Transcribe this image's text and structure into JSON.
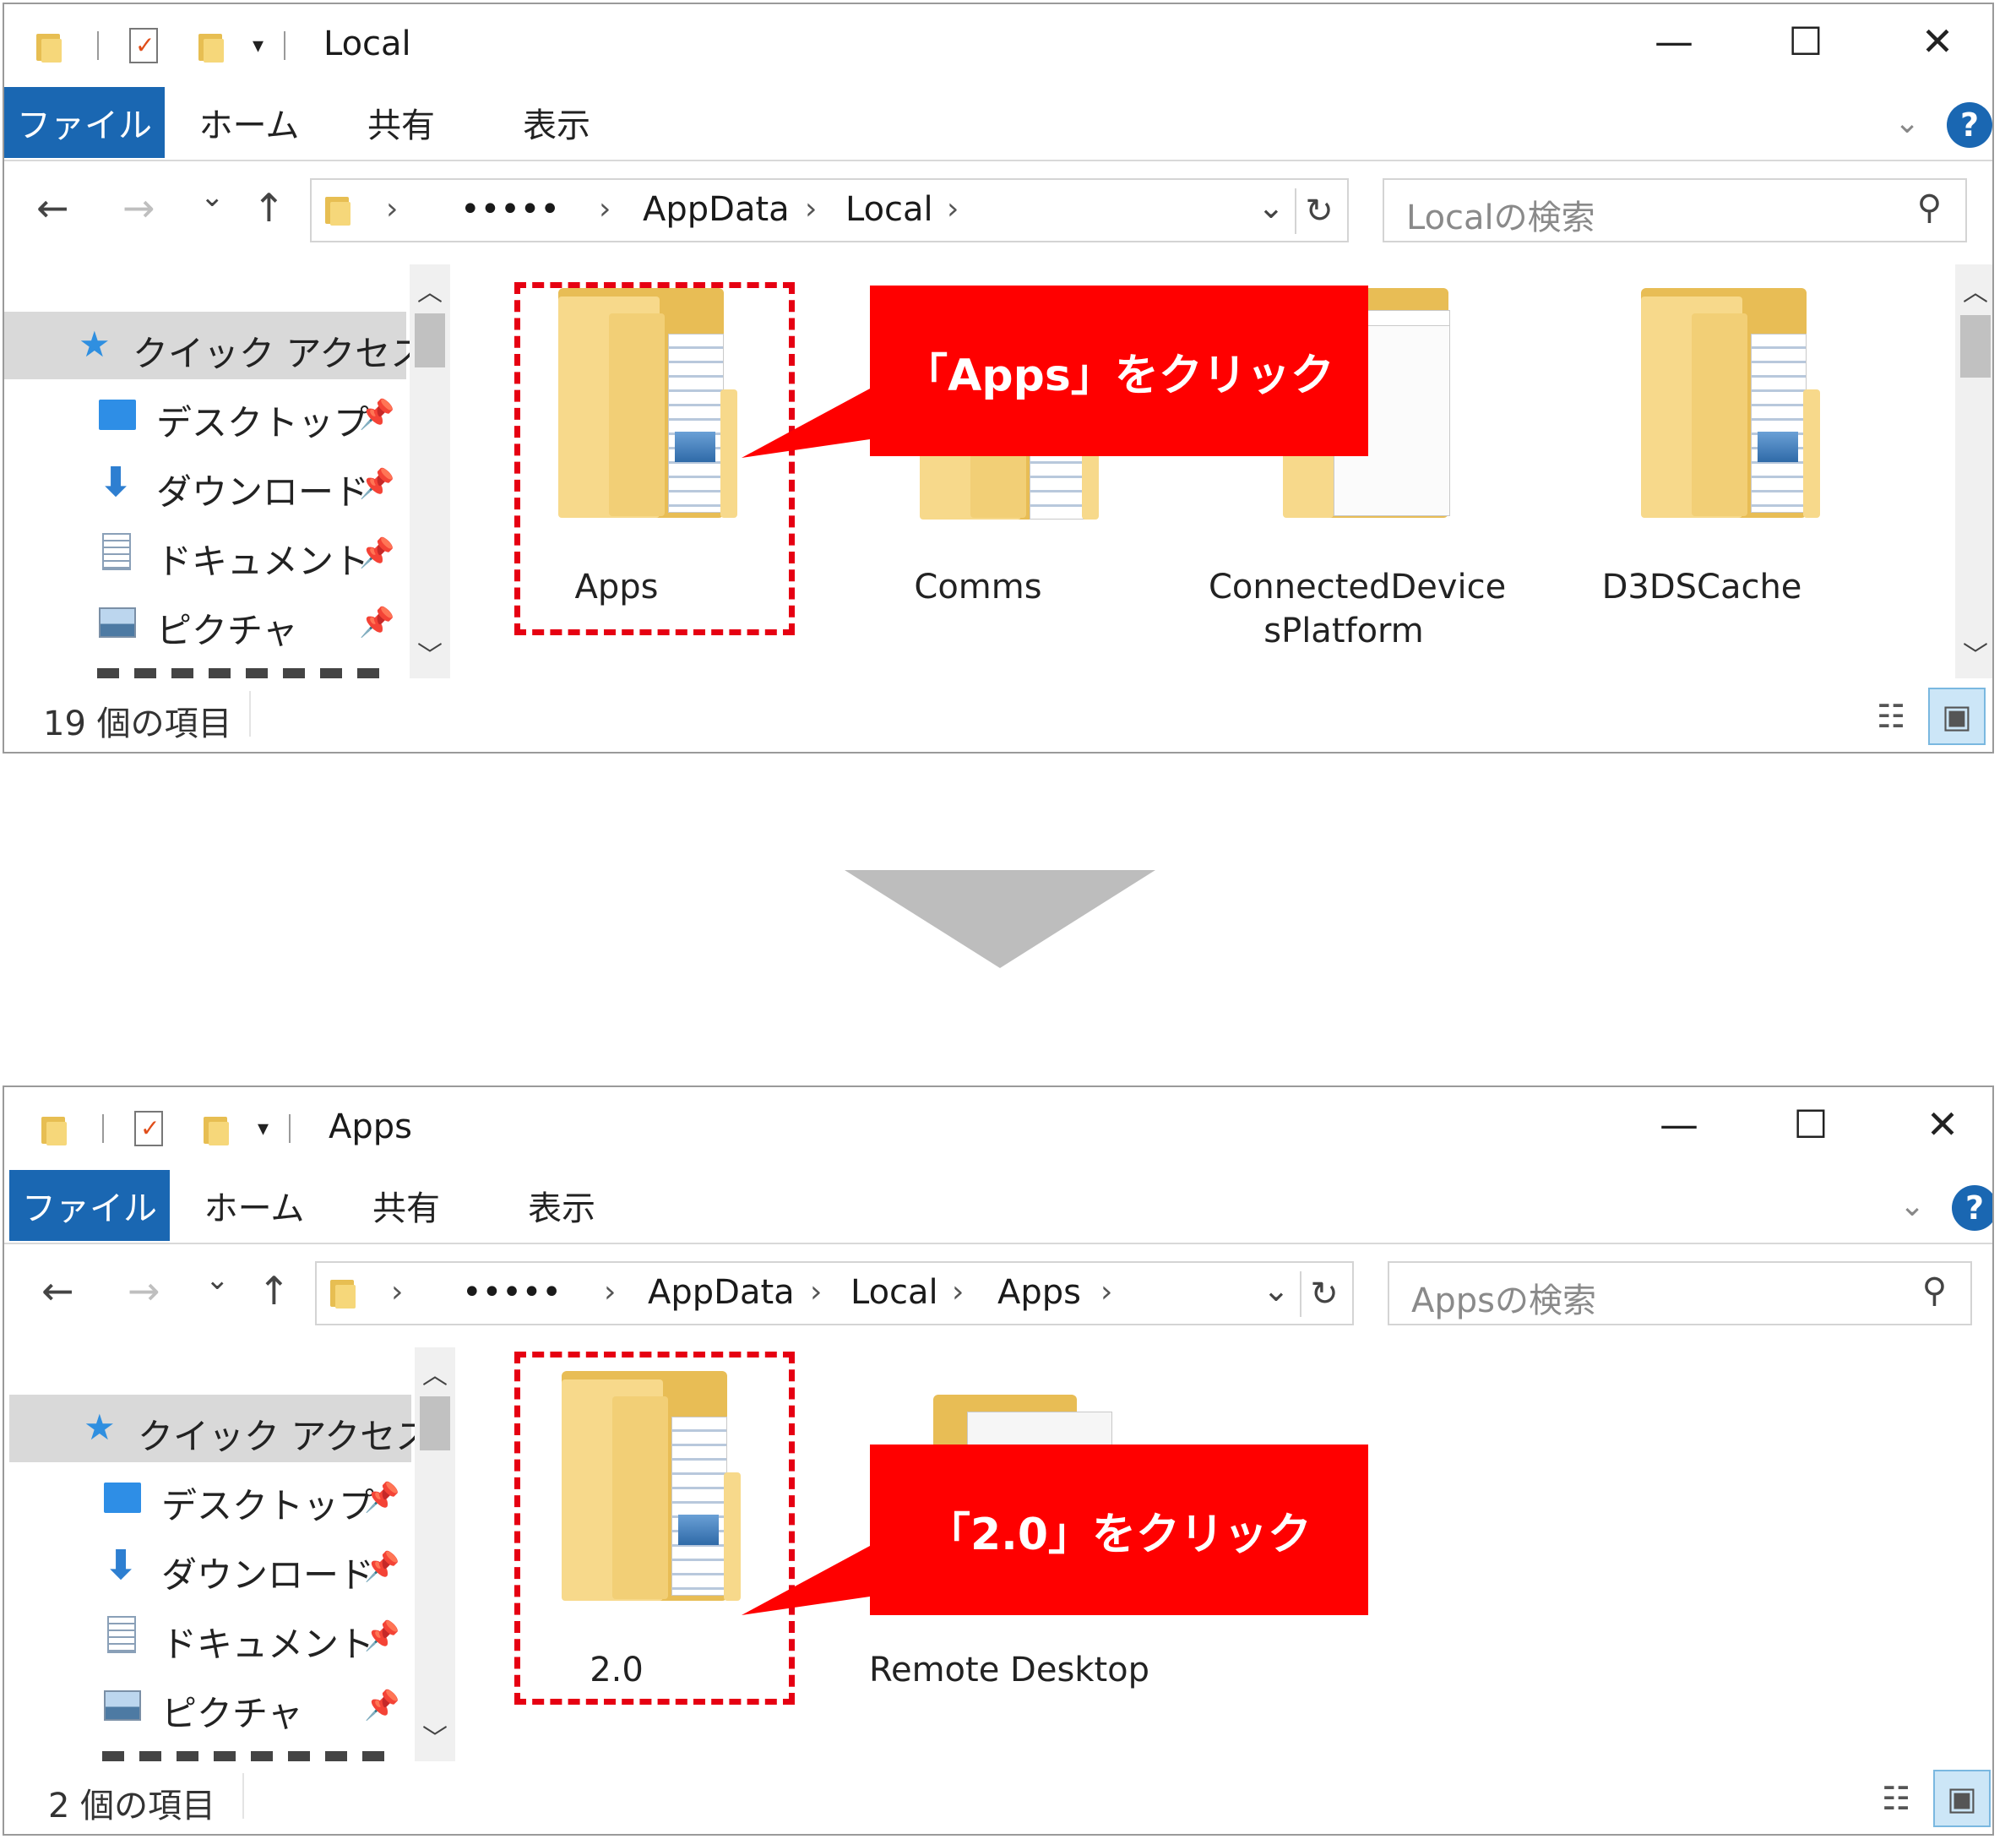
{
  "common": {
    "min_glyph": "—",
    "max_glyph": "☐",
    "close_glyph": "✕",
    "tabs": {
      "file": "ファイル",
      "home": "ホーム",
      "share": "共有",
      "view": "表示"
    },
    "help": "?",
    "back": "←",
    "forward": "→",
    "recent": "⌄",
    "up": "↑",
    "refresh": "↻",
    "addr_dropdown": "⌄",
    "search_icon": "⚲",
    "nav_items": {
      "quick_access": "クイック アクセス",
      "desktop": "デスクトップ",
      "downloads": "ダウンロード",
      "documents": "ドキュメント",
      "pictures": "ピクチャ"
    },
    "pin": "📌",
    "colors": {
      "accent": "#1a67b2",
      "callout": "#ff0000",
      "dash": "#e60012",
      "folder": "#f7d98b"
    }
  },
  "window1": {
    "title": "Local",
    "breadcrumbs": [
      "•••••",
      "AppData",
      "Local"
    ],
    "search_placeholder": "Localの検索",
    "items": [
      "Apps",
      "Comms",
      "ConnectedDevicesPlatform",
      "D3DSCache"
    ],
    "item_lines": {
      "connected_1": "ConnectedDevice",
      "connected_2": "sPlatform"
    },
    "status": "19 個の項目",
    "callout": "「Apps」をクリック"
  },
  "window2": {
    "title": "Apps",
    "breadcrumbs": [
      "•••••",
      "AppData",
      "Local",
      "Apps"
    ],
    "search_placeholder": "Appsの検索",
    "items": [
      "2.0",
      "Remote Desktop"
    ],
    "status": "2 個の項目",
    "callout": "「2.0」をクリック"
  }
}
